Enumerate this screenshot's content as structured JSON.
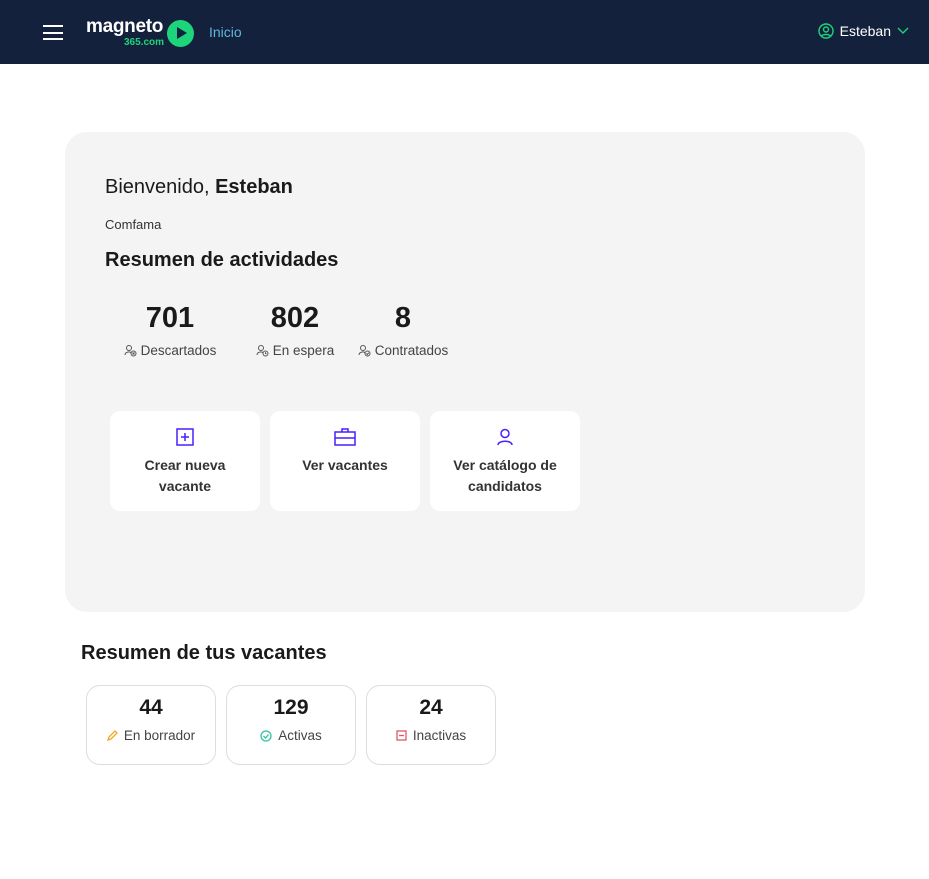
{
  "header": {
    "logo_text": "magneto",
    "logo_sub": "365.com",
    "nav_link": "Inicio",
    "user_name": "Esteban"
  },
  "welcome": {
    "greeting": "Bienvenido,",
    "name": "Esteban",
    "company": "Comfama"
  },
  "activities": {
    "title": "Resumen de actividades",
    "stats": [
      {
        "value": "701",
        "label": "Descartados"
      },
      {
        "value": "802",
        "label": "En espera"
      },
      {
        "value": "8",
        "label": "Contratados"
      }
    ]
  },
  "actions": [
    {
      "label": "Crear nueva vacante",
      "icon": "plus-square-icon"
    },
    {
      "label": "Ver vacantes",
      "icon": "briefcase-icon"
    },
    {
      "label": "Ver catálogo de candidatos",
      "icon": "user-icon"
    }
  ],
  "vacancies": {
    "title": "Resumen de tus vacantes",
    "items": [
      {
        "value": "44",
        "label": "En borrador",
        "color": "#f5a623"
      },
      {
        "value": "129",
        "label": "Activas",
        "color": "#2ec4a0"
      },
      {
        "value": "24",
        "label": "Inactivas",
        "color": "#e0566b"
      }
    ]
  },
  "colors": {
    "nav_bg": "#14213d",
    "brand_green": "#1ed47a",
    "accent_purple": "#4a1fff"
  }
}
